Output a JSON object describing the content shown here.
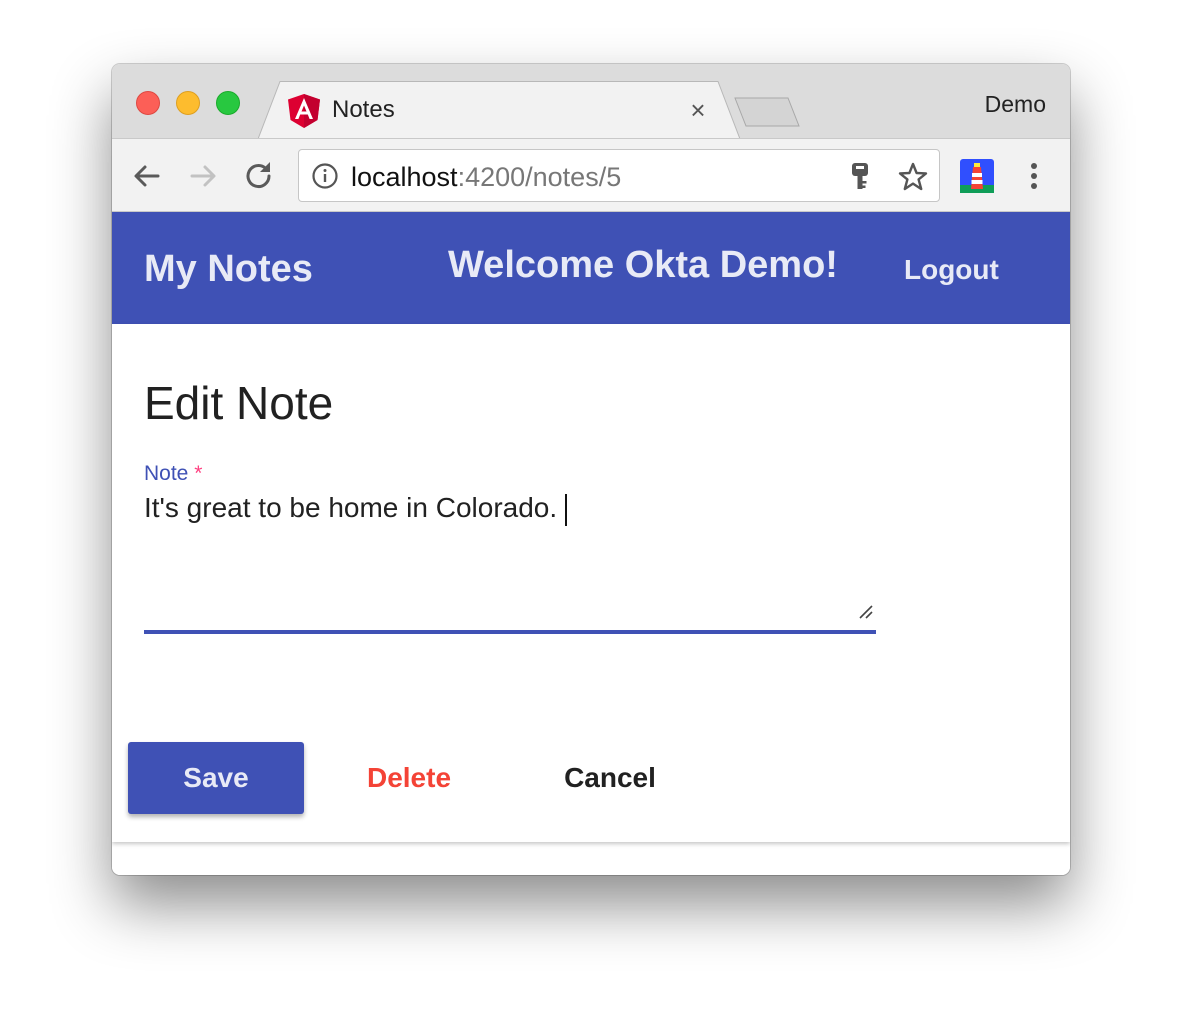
{
  "browser": {
    "tab_title": "Notes",
    "tab_close": "×",
    "profile_name": "Demo",
    "url_host": "localhost",
    "url_rest": ":4200/notes/5",
    "icons": {
      "tab": "angular-logo-icon",
      "back": "arrow-left-icon",
      "forward": "arrow-right-icon",
      "reload": "reload-icon",
      "info": "info-icon",
      "key": "key-icon",
      "star": "star-icon",
      "extension": "lighthouse-icon",
      "menu": "more-vert-icon"
    }
  },
  "appbar": {
    "title": "My Notes",
    "welcome": "Welcome Okta Demo!",
    "logout_label": "Logout",
    "color": "#3f51b5"
  },
  "form": {
    "heading": "Edit Note",
    "note_label": "Note",
    "required_marker": "*",
    "note_value": "It's great to be home in Colorado."
  },
  "actions": {
    "save_label": "Save",
    "delete_label": "Delete",
    "cancel_label": "Cancel",
    "delete_color": "#f44336"
  }
}
